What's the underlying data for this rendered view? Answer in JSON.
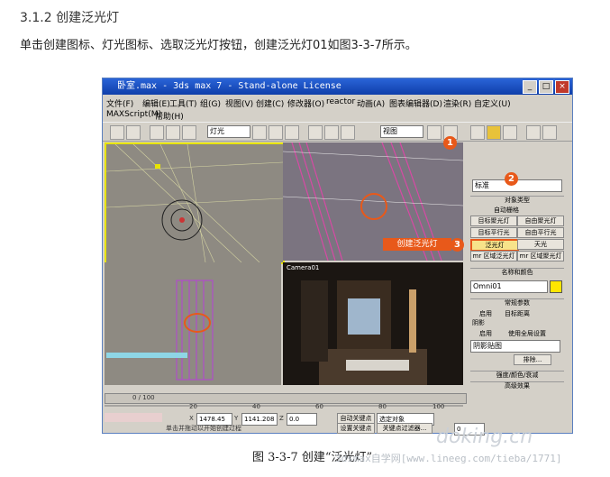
{
  "section_title": "3.1.2 创建泛光灯",
  "paragraph": "单击创建图标、灯光图标、选取泛光灯按钮，创建泛光灯01如图3-3-7所示。",
  "window": {
    "title": "卧室.max - 3ds max 7  -  Stand-alone License",
    "controls": [
      "_",
      "□",
      "×"
    ]
  },
  "menu": [
    "文件(F)",
    "编辑(E)",
    "工具(T)",
    "组(G)",
    "视图(V)",
    "创建(C)",
    "修改器(O)",
    "reactor",
    "动画(A)",
    "图表编辑器(D)",
    "渲染(R)",
    "自定义(U)"
  ],
  "menu2": [
    "MAXScript(M)",
    "帮助(H)"
  ],
  "toolbar": {
    "combo1": "灯光",
    "combo2": "视图"
  },
  "viewports": {
    "perspective_label": "Camera01"
  },
  "panel": {
    "category": "标准",
    "rollout_object_type": "对象类型",
    "auto_grid": "自动栅格",
    "buttons": [
      "目标聚光灯",
      "自由聚光灯",
      "目标平行光",
      "自由平行光",
      "泛光灯",
      "天光",
      "mr 区域泛光灯",
      "mr 区域聚光灯"
    ],
    "rollout_name_color": "名称和颜色",
    "name_value": "Omni01",
    "rollout_general": "常规参数",
    "enable": "启用",
    "target_distance": "目标距离",
    "shadows": "阴影",
    "shadow_enable": "启用",
    "use_global": "使用全局设置",
    "shadow_type": "阴影贴图",
    "exclude": "排除...",
    "rollout_intensity": "强度/颜色/衰减",
    "rollout_advanced": "高级效果"
  },
  "callouts": {
    "one": "1",
    "two": "2",
    "three": "3",
    "label": "创建泛光灯"
  },
  "timeline": {
    "frame": "0 / 100",
    "ticks": [
      "0",
      "20",
      "40",
      "60",
      "80",
      "100"
    ]
  },
  "status": {
    "x_label": "X",
    "x": "1478.45",
    "y_label": "Y",
    "y": "1141.208",
    "z_label": "Z",
    "z": "0.0",
    "auto_key": "自动关键点",
    "select_obj": "选定对象",
    "set_key": "设置关键点",
    "key_filter": "关键点过滤器...",
    "prompt": "单击并拖动以开始创建过程",
    "frame_val": "0"
  },
  "caption": "图 3-3-7   创建“泛光灯”",
  "watermark1": "doking.cn",
  "watermark2": "3dsmax自学网[www.lineeg.com/tieba/1771]",
  "colors": {
    "accent": "#e8591a",
    "titlebar": "#0f3faa",
    "viewport_active": "#e8e400"
  }
}
